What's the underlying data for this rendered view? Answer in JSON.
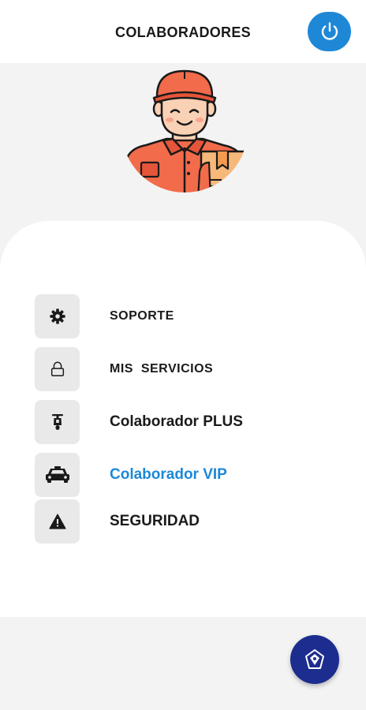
{
  "header": {
    "title": "COLABORADORES",
    "power_icon": "power-icon"
  },
  "menu": {
    "items": [
      {
        "label": "SOPORTE",
        "icon": "gear-icon"
      },
      {
        "label": "MIS  SERVICIOS",
        "icon": "lock-icon"
      },
      {
        "label": "Colaborador PLUS",
        "icon": "scooter-icon"
      },
      {
        "label": "Colaborador VIP",
        "icon": "car-icon",
        "active": true
      },
      {
        "label": "SEGURIDAD",
        "icon": "warning-icon"
      }
    ]
  },
  "fab": {
    "icon": "app-logo-icon"
  },
  "colors": {
    "accent": "#1e88d6",
    "fab": "#1d2d8f",
    "avatar_shirt": "#f26b4b",
    "avatar_box": "#f7b97a"
  }
}
